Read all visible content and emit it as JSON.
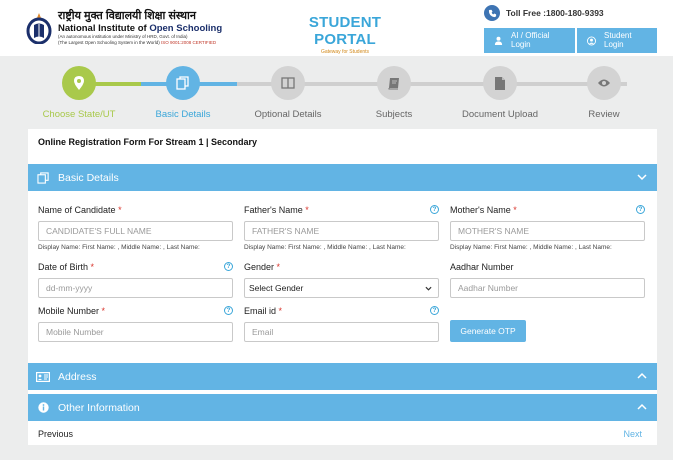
{
  "header": {
    "logo_hindi": "राष्ट्रीय मुक्त विद्यालयी शिक्षा संस्थान",
    "logo_english_prefix": "National Institute of ",
    "logo_english_emph": "Open Schooling",
    "logo_sub1": "(An autonomous institution under Ministry of HRD, Govt. of India)",
    "logo_sub2": "(The Largest Open Schooling System in the World)",
    "logo_iso": "ISO 9001:2008 CERTIFIED",
    "portal_title": "STUDENT PORTAL",
    "portal_subtitle": "Gateway for Students",
    "toll_free": "Toll Free :1800-180-9393",
    "login_ai_line1": "AI / Official",
    "login_ai_line2": "Login",
    "login_student_line1": "Student",
    "login_student_line2": "Login"
  },
  "stepper": {
    "steps": [
      {
        "label": "Choose State/UT",
        "state": "completed"
      },
      {
        "label": "Basic Details",
        "state": "active"
      },
      {
        "label": "Optional Details",
        "state": "pending"
      },
      {
        "label": "Subjects",
        "state": "pending"
      },
      {
        "label": "Document Upload",
        "state": "pending"
      },
      {
        "label": "Review",
        "state": "pending"
      }
    ]
  },
  "form": {
    "title": "Online Registration Form For Stream 1 | Secondary",
    "section_basic": "Basic Details",
    "section_address": "Address",
    "section_other": "Other Information",
    "candidate_name": {
      "label": "Name of Candidate",
      "required": "*",
      "placeholder": "CANDIDATE'S FULL NAME",
      "hint": "Display Name: First Name: , Middle Name: , Last Name:"
    },
    "father_name": {
      "label": "Father's Name",
      "required": "*",
      "placeholder": "FATHER'S NAME",
      "hint": "Display Name: First Name: , Middle Name: , Last Name:"
    },
    "mother_name": {
      "label": "Mother's Name",
      "required": "*",
      "placeholder": "MOTHER'S NAME",
      "hint": "Display Name: First Name: , Middle Name: , Last Name:"
    },
    "dob": {
      "label": "Date of Birth",
      "required": "*",
      "placeholder": "dd-mm-yyyy"
    },
    "gender": {
      "label": "Gender",
      "required": "*",
      "selected": "Select Gender"
    },
    "aadhar": {
      "label": "Aadhar Number",
      "placeholder": "Aadhar Number"
    },
    "mobile": {
      "label": "Mobile Number",
      "required": "*",
      "placeholder": "Mobile Number"
    },
    "email": {
      "label": "Email id",
      "required": "*",
      "placeholder": "Email"
    },
    "otp_button": "Generate OTP",
    "help_glyph": "?",
    "previous": "Previous",
    "next": "Next"
  },
  "colors": {
    "accent_blue": "#62b4e4",
    "step_green": "#a9c94b",
    "required_red": "#d9342b"
  }
}
